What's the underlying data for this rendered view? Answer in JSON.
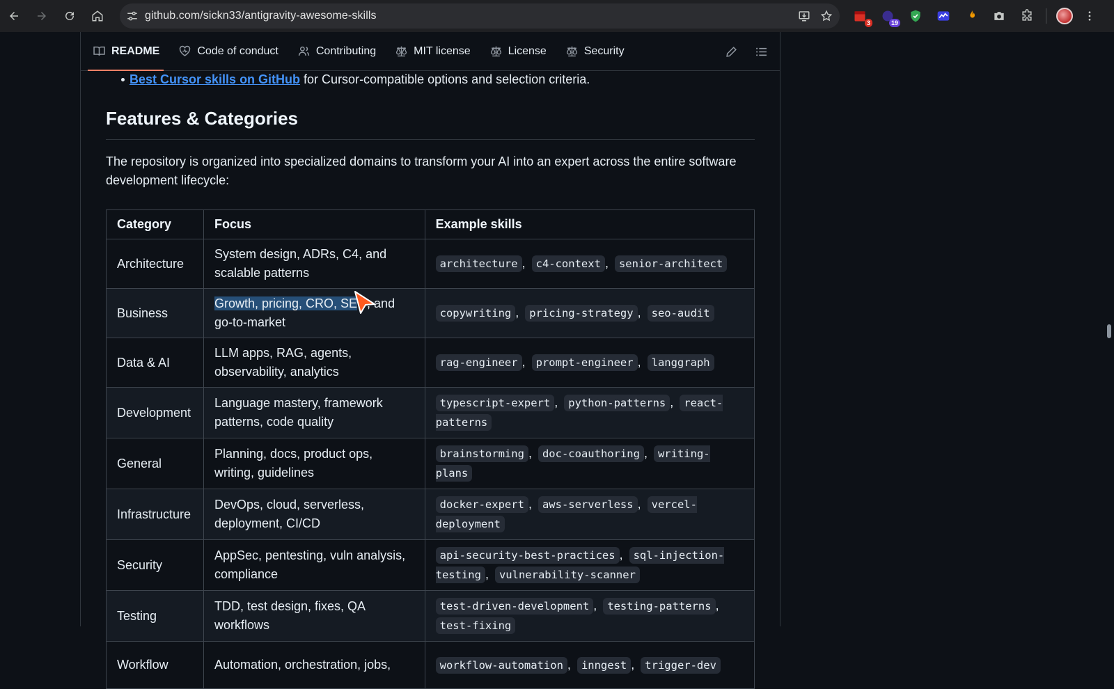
{
  "browser": {
    "url": "github.com/sickn33/antigravity-awesome-skills",
    "extensions": [
      {
        "name": "calendar-ext-icon",
        "badge": "3",
        "color": "#d93025",
        "badge_color": "#d93025"
      },
      {
        "name": "tracker-ext-icon",
        "badge": "19",
        "color": "#5b4bd6",
        "badge_color": "#6741d9"
      },
      {
        "name": "shield-ext-icon",
        "badge": "",
        "color": "#34a853"
      },
      {
        "name": "chart-ext-icon",
        "badge": "",
        "color": "#3b3fe0"
      },
      {
        "name": "flame-ext-icon",
        "badge": "",
        "color": "#f29900"
      },
      {
        "name": "camera-ext-icon",
        "badge": "",
        "color": "#c4c7c5"
      },
      {
        "name": "puzzle-icon",
        "badge": "",
        "color": "#c4c7c5"
      }
    ]
  },
  "readme_tabs": [
    {
      "label": "README",
      "icon": "book-icon",
      "active": true
    },
    {
      "label": "Code of conduct",
      "icon": "heart-icon",
      "active": false
    },
    {
      "label": "Contributing",
      "icon": "people-icon",
      "active": false
    },
    {
      "label": "MIT license",
      "icon": "law-icon",
      "active": false
    },
    {
      "label": "License",
      "icon": "law-icon",
      "active": false
    },
    {
      "label": "Security",
      "icon": "law-icon",
      "active": false
    }
  ],
  "content": {
    "bullet_link": "Best Cursor skills on GitHub",
    "bullet_rest": " for Cursor-compatible options and selection criteria.",
    "heading": "Features & Categories",
    "intro": "The repository is organized into specialized domains to transform your AI into an expert across the entire software development lifecycle:"
  },
  "table": {
    "headers": [
      "Category",
      "Focus",
      "Example skills"
    ],
    "rows": [
      {
        "category": "Architecture",
        "focus": "System design, ADRs, C4, and scalable patterns",
        "skills": [
          "architecture",
          "c4-context",
          "senior-architect"
        ]
      },
      {
        "category": "Business",
        "focus": "Growth, pricing, CRO, SEO, and go-to-market",
        "focus_highlight": "Growth, pricing, CRO, SE",
        "skills": [
          "copywriting",
          "pricing-strategy",
          "seo-audit"
        ]
      },
      {
        "category": "Data & AI",
        "focus": "LLM apps, RAG, agents, observability, analytics",
        "skills": [
          "rag-engineer",
          "prompt-engineer",
          "langgraph"
        ]
      },
      {
        "category": "Development",
        "focus": "Language mastery, framework patterns, code quality",
        "skills": [
          "typescript-expert",
          "python-patterns",
          "react-patterns"
        ]
      },
      {
        "category": "General",
        "focus": "Planning, docs, product ops, writing, guidelines",
        "skills": [
          "brainstorming",
          "doc-coauthoring",
          "writing-plans"
        ]
      },
      {
        "category": "Infrastructure",
        "focus": "DevOps, cloud, serverless, deployment, CI/CD",
        "skills": [
          "docker-expert",
          "aws-serverless",
          "vercel-deployment"
        ]
      },
      {
        "category": "Security",
        "focus": "AppSec, pentesting, vuln analysis, compliance",
        "skills": [
          "api-security-best-practices",
          "sql-injection-testing",
          "vulnerability-scanner"
        ]
      },
      {
        "category": "Testing",
        "focus": "TDD, test design, fixes, QA workflows",
        "skills": [
          "test-driven-development",
          "testing-patterns",
          "test-fixing"
        ]
      },
      {
        "category": "Workflow",
        "focus": "Automation, orchestration, jobs,",
        "skills": [
          "workflow-automation",
          "inngest",
          "trigger-dev"
        ]
      }
    ]
  }
}
